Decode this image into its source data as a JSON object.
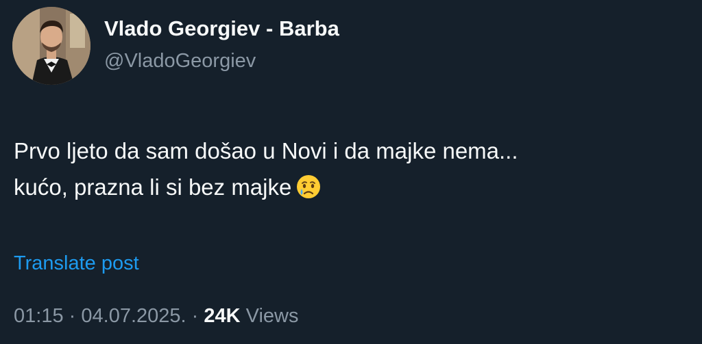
{
  "author": {
    "display_name": "Vlado Georgiev - Barba",
    "handle": "@VladoGeorgiev",
    "avatar_icon": "profile-photo"
  },
  "tweet": {
    "lines": [
      "Prvo ljeto da sam došao u Novi i da majke nema...",
      "kućo, prazna li si bez majke"
    ],
    "emoji": "crying-face-icon"
  },
  "actions": {
    "translate_label": "Translate post"
  },
  "meta": {
    "time": "01:15",
    "separator": "·",
    "date": "04.07.2025.",
    "views_count": "24K",
    "views_label": "Views"
  },
  "colors": {
    "background": "#15202b",
    "text": "#f7f9f9",
    "secondary": "#8b98a5",
    "link": "#1d9bf0"
  }
}
